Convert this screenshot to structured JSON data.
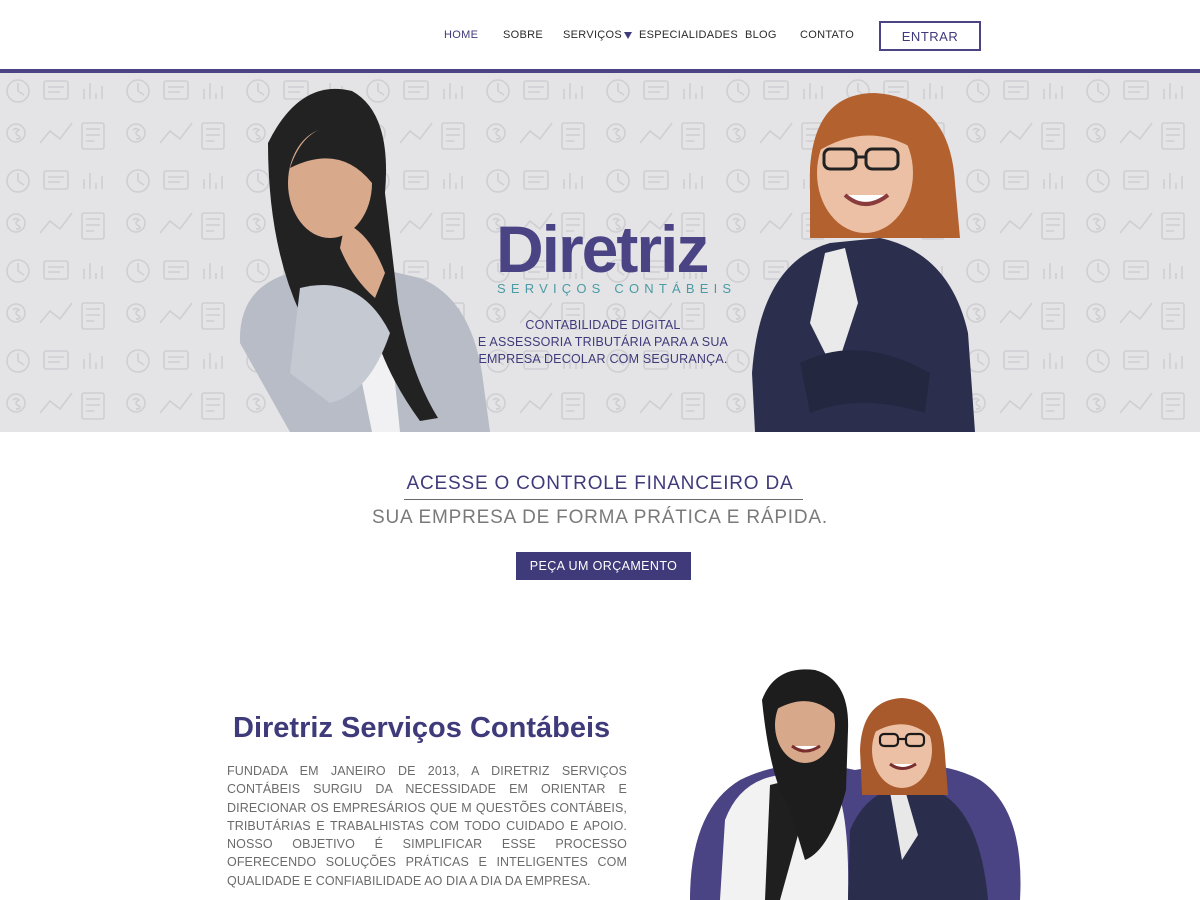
{
  "nav": {
    "items": [
      {
        "label": "HOME",
        "active": true
      },
      {
        "label": "SOBRE"
      },
      {
        "label": "SERVIÇOS",
        "has_dropdown": true
      },
      {
        "label": "ESPECIALIDADES"
      },
      {
        "label": "BLOG"
      },
      {
        "label": "CONTATO"
      }
    ],
    "login_label": "ENTRAR"
  },
  "hero": {
    "logo_word": "Diretriz",
    "logo_sub": "SERVIÇOS CONTÁBEIS",
    "tagline_lines": [
      "CONTABILIDADE DIGITAL",
      "E ASSESSORIA TRIBUTÁRIA PARA A SUA",
      "EMPRESA DECOLAR COM SEGURANÇA."
    ]
  },
  "cta": {
    "line1": "ACESSE O CONTROLE FINANCEIRO DA",
    "line2": "SUA EMPRESA DE FORMA PRÁTICA E RÁPIDA.",
    "button_label": "PEÇA UM ORÇAMENTO"
  },
  "about": {
    "title": "Diretriz Serviços Contábeis",
    "text": "FUNDADA EM JANEIRO DE 2013, A DIRETRIZ SERVIÇOS CONTÁBEIS SURGIU DA NECESSIDADE EM ORIENTAR E DIRECIONAR OS EMPRESÁRIOS QUE M QUESTÕES CONTÁBEIS, TRIBUTÁRIAS E TRABALHISTAS COM TODO CUIDADO E APOIO. NOSSO OBJETIVO É SIMPLIFICAR ESSE PROCESSO OFERECENDO SOLUÇÕES PRÁTICAS E INTELIGENTES COM QUALIDADE E CONFIABILIDADE AO DIA A DIA DA EMPRESA."
  },
  "colors": {
    "brand_purple": "#4a4384",
    "accent_teal": "#4a9ba5",
    "hero_bg": "#e4e4e6"
  }
}
